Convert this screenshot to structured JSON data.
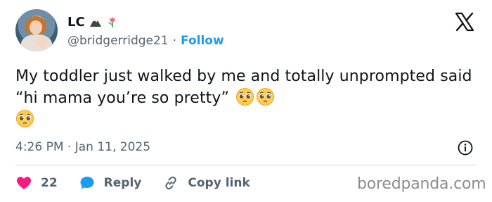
{
  "user": {
    "name": "LC",
    "handle": "@bridgerridge21",
    "separator": "·",
    "follow_label": "Follow",
    "name_icons": [
      "mountain-icon",
      "tulip-icon"
    ]
  },
  "tweet": {
    "text": "My toddler just walked by me and totally unprompted said “hi mama you’re so pretty”",
    "emojis": [
      "pleading-face-icon",
      "pleading-face-icon",
      "pleading-face-icon"
    ],
    "time": "4:26 PM",
    "separator": "·",
    "date": "Jan 11, 2025"
  },
  "actions": {
    "likes_count": "22",
    "reply_label": "Reply",
    "copy_link_label": "Copy link"
  },
  "watermark": "boredpanda.com",
  "colors": {
    "accent": "#1d9bf0",
    "heart": "#f91880",
    "text": "#0f1419",
    "secondary": "#536471"
  }
}
